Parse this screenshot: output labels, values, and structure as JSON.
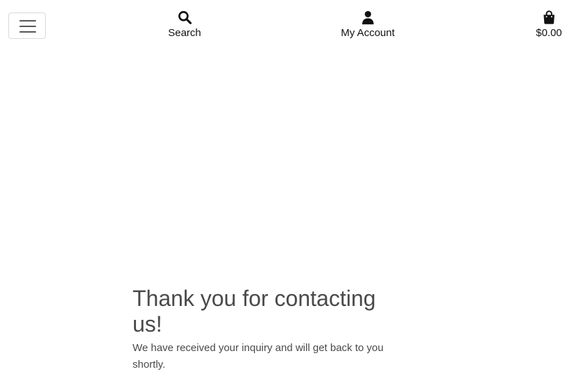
{
  "header": {
    "nav": {
      "search_label": "Search",
      "account_label": "My Account",
      "cart_total": "$0.00"
    },
    "icons": {
      "menu": "hamburger-menu-icon",
      "search": "search-icon",
      "account": "user-icon",
      "cart": "shopping-bag-icon"
    }
  },
  "main": {
    "heading": "Thank you for contacting us!",
    "message": "We have received your inquiry and will get back to you shortly."
  },
  "colors": {
    "text_dark": "#111111",
    "text_body": "#4a4a4a",
    "border": "#d9d9d9",
    "background": "#ffffff"
  }
}
